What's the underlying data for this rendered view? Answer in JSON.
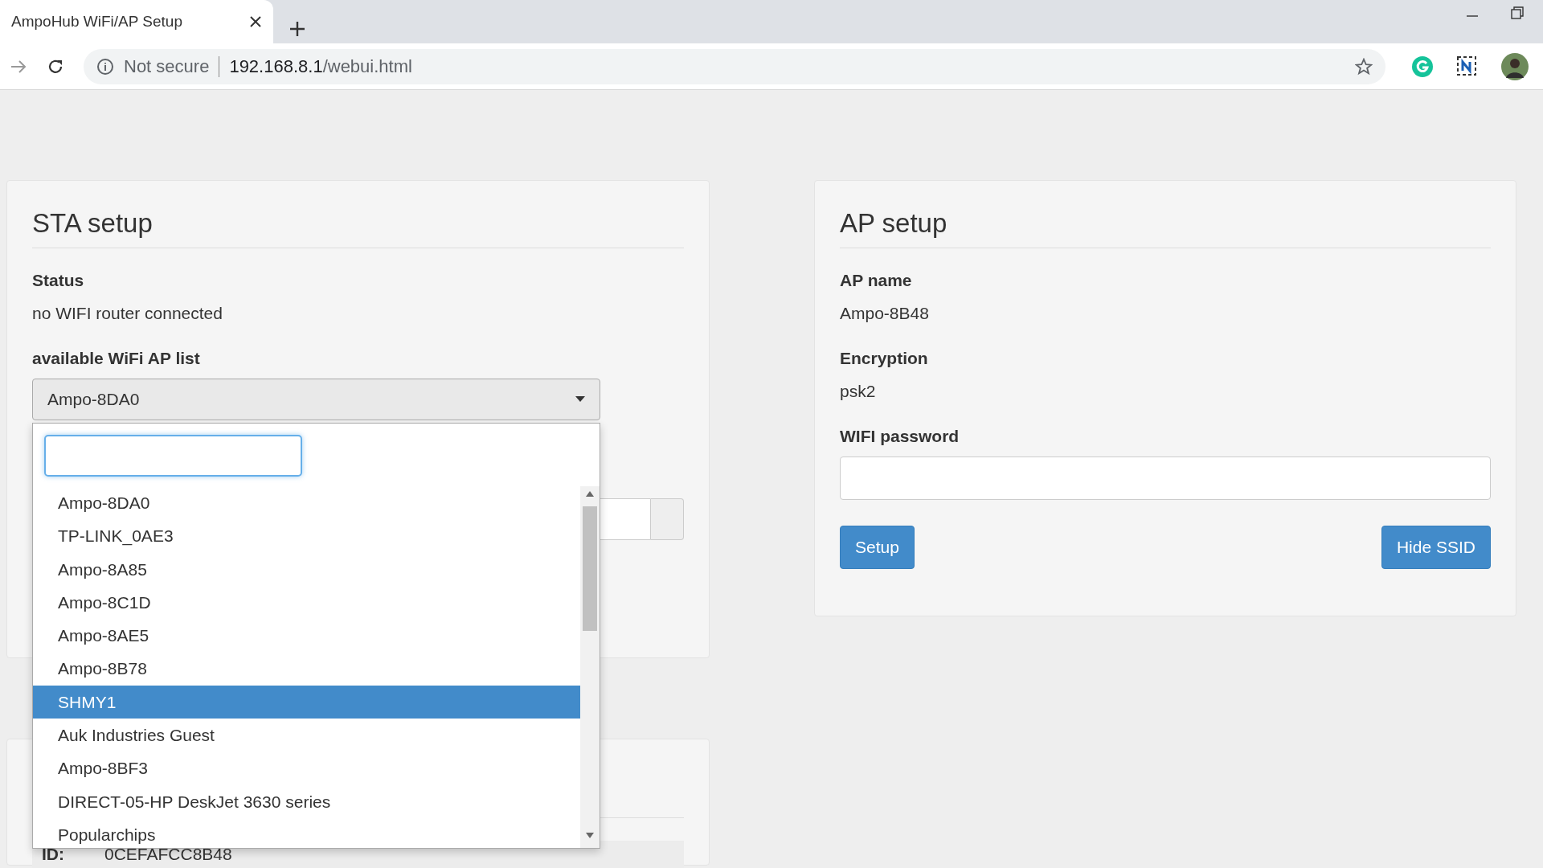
{
  "browser": {
    "tab": {
      "title": "AmpoHub WiFi/AP Setup"
    },
    "address": {
      "security": "Not secure",
      "host": "192.168.8.1",
      "path": "/webui.html"
    }
  },
  "sta": {
    "title": "STA setup",
    "status_label": "Status",
    "status": "no WIFI router connected",
    "list_label": "available WiFi AP list",
    "selected_value": "Ampo-8DA0",
    "options": [
      {
        "label": "Ampo-8DA0",
        "selected": false
      },
      {
        "label": "TP-LINK_0AE3",
        "selected": false
      },
      {
        "label": "Ampo-8A85",
        "selected": false
      },
      {
        "label": "Ampo-8C1D",
        "selected": false
      },
      {
        "label": "Ampo-8AE5",
        "selected": false
      },
      {
        "label": "Ampo-8B78",
        "selected": false
      },
      {
        "label": "SHMY1",
        "selected": true
      },
      {
        "label": "Auk Industries Guest",
        "selected": false
      },
      {
        "label": "Ampo-8BF3",
        "selected": false
      },
      {
        "label": "DIRECT-05-HP DeskJet 3630 series",
        "selected": false
      },
      {
        "label": "Popularchips",
        "selected": false
      }
    ]
  },
  "device": {
    "id_label": "ID:",
    "id": "0CEFAFCC8B48"
  },
  "ap": {
    "title": "AP setup",
    "name_label": "AP name",
    "name": "Ampo-8B48",
    "encryption_label": "Encryption",
    "encryption": "psk2",
    "password_label": "WIFI password",
    "buttons": [
      "Setup",
      "Hide SSID"
    ]
  }
}
